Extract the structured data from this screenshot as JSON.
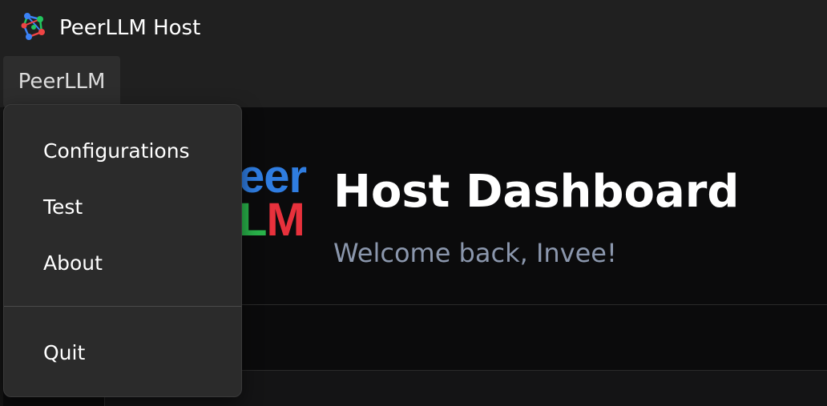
{
  "window": {
    "title": "PeerLLM Host"
  },
  "menubar": {
    "items": [
      {
        "label": "PeerLLM"
      }
    ]
  },
  "dropdown": {
    "items": [
      {
        "label": "Configurations"
      },
      {
        "label": "Test"
      },
      {
        "label": "About"
      }
    ],
    "quit_label": "Quit"
  },
  "dashboard": {
    "logo_line1": "eer",
    "logo_line2_green": "L",
    "logo_line2_red": "M",
    "title": "Host Dashboard",
    "subtitle": "Welcome back, Invee!"
  },
  "icons": {
    "app": "network-nodes-icon"
  },
  "colors": {
    "background": "#202020",
    "content_bg": "#0b0b0c",
    "menu_bg": "#2b2b2b",
    "logo_blue": "#2f7de1",
    "logo_green": "#29b34a",
    "logo_red": "#e8313c",
    "subtitle": "#8b97ad"
  }
}
